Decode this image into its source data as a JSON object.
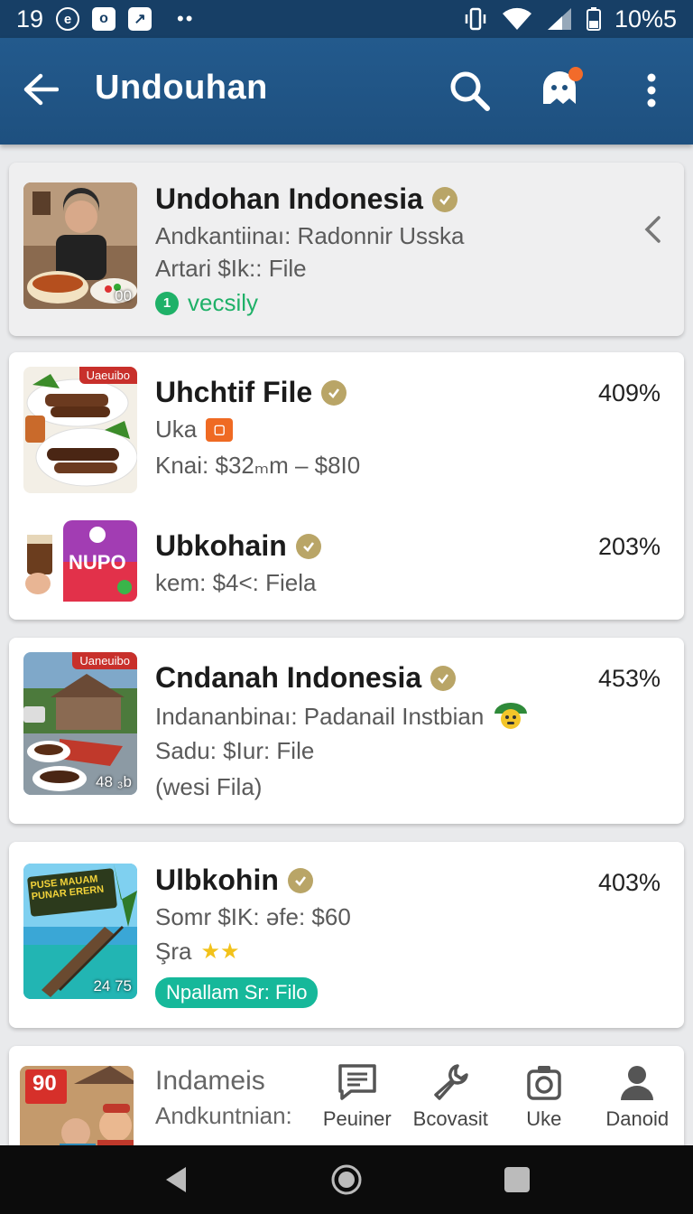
{
  "status": {
    "time": "19",
    "battery": "10%5"
  },
  "appbar": {
    "title": "Undouhan"
  },
  "items": [
    {
      "title": "Undohan Indonesia",
      "line1": "Andkantiinaı: Radonnir Usska",
      "line2": "Artari $Ik:: File",
      "status_num": "1",
      "status": "vecsily",
      "thumb_badge": "00"
    },
    {
      "title": "Uhchtif File",
      "line1": "Uka",
      "line2": "Knai: $32ₘm – $8I0",
      "pct": "409%",
      "thumb_corner": "Uaeuibo"
    },
    {
      "title": "Ubkohain",
      "line1": "kem: $4<: Fiela",
      "pct": "203%",
      "thumb_text": "NUPO"
    },
    {
      "title": "Cndanah Indonesia",
      "line1": "Indananbinaı: Padanail Instbian",
      "line2": "Sadu: $Iur: File",
      "line3": "(wesi Fila)",
      "pct": "453%",
      "thumb_corner": "Uaneuibo",
      "thumb_label": "48 ₃b"
    },
    {
      "title": "Ulbkohin",
      "line1": "Somr $IK: əfe: $60",
      "line2": "Şra",
      "pill": "Npallam Sr: Filo",
      "pct": "403%",
      "thumb_label": "24 75",
      "thumb_sign": "PUSE MAUAM PUNAR ERERN"
    },
    {
      "title": "Indameis",
      "line1": "Andkuntnian:",
      "thumb_text": "90"
    }
  ],
  "tabs": [
    {
      "label": "Peuiner",
      "icon": "chat-icon"
    },
    {
      "label": "Bcovasit",
      "icon": "wrench-icon"
    },
    {
      "label": "Uke",
      "icon": "camera-icon"
    },
    {
      "label": "Danoid",
      "icon": "person-icon"
    }
  ],
  "colors": {
    "appbar": "#1e507f",
    "statusbar": "#173f66",
    "verified": "#b9a567",
    "green": "#1fb168",
    "teal": "#16b89a",
    "notif": "#f26b2a"
  }
}
